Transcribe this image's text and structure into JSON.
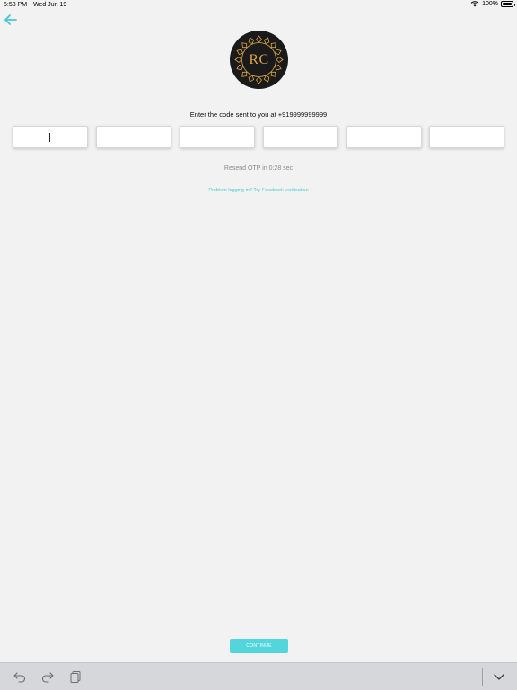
{
  "status_bar": {
    "time": "5:53 PM",
    "date": "Wed Jun 19",
    "battery": "100%",
    "battery_level": 1.0
  },
  "logo": {
    "text": "RC"
  },
  "otp": {
    "prompt": "Enter the code sent to you at +919999999999",
    "values": [
      "",
      "",
      "",
      "",
      "",
      ""
    ],
    "resend": "Resend OTP in 0:28 sec",
    "problem_link": "Problem logging in? Try Facebook verification"
  },
  "continue_label": "CONTINUE",
  "colors": {
    "accent": "#52d6dc",
    "link": "#4ec9c9",
    "logo_bg": "#1a1a1a",
    "logo_gold": "#d9a648",
    "background": "#f2f2f2"
  },
  "icons": {
    "back": "arrow-left-icon",
    "undo": "undo-icon",
    "redo": "redo-icon",
    "paste": "paste-icon",
    "dismiss": "chevron-down-icon"
  }
}
